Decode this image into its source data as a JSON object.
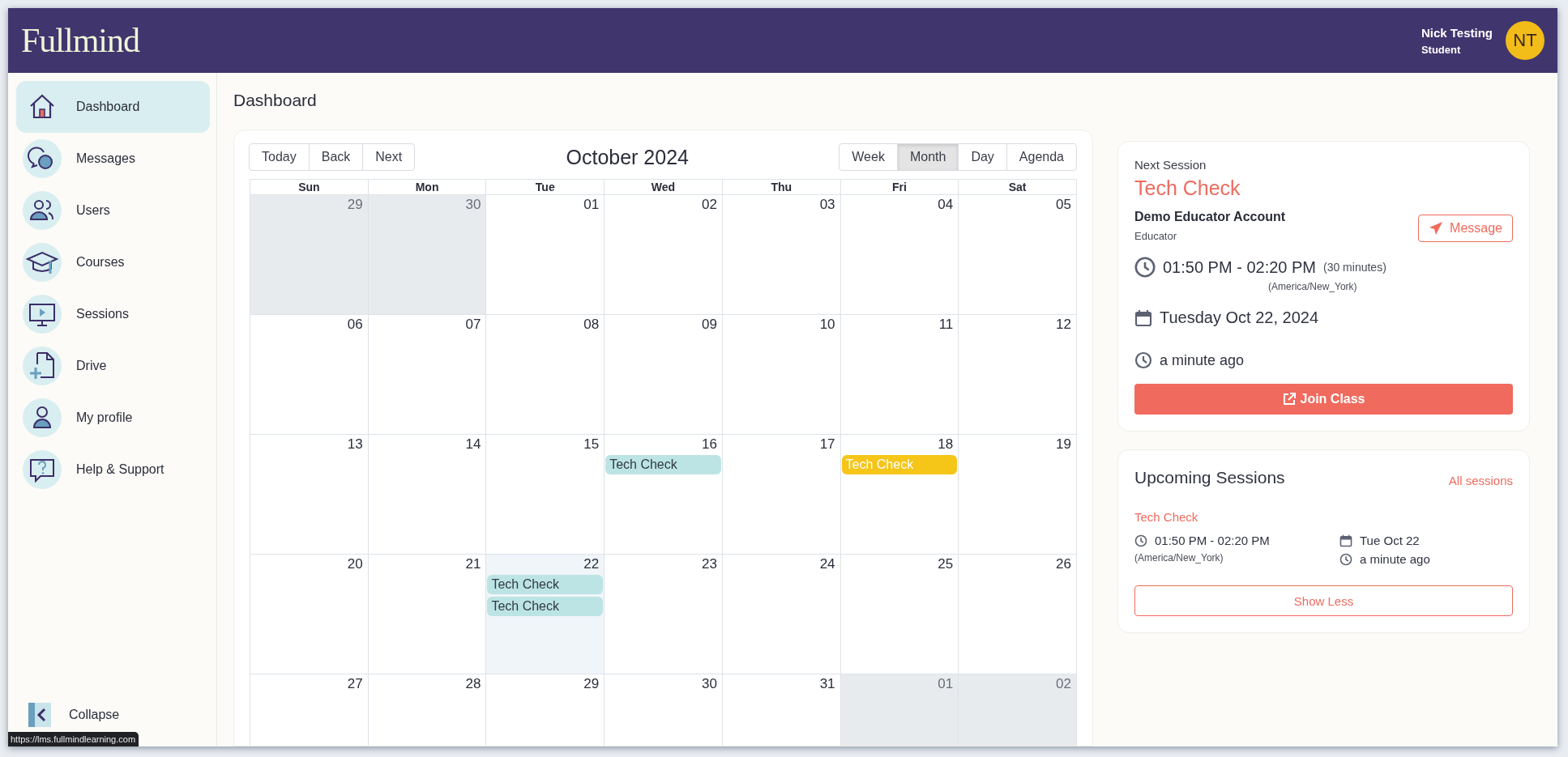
{
  "header": {
    "logo": "Fullmind",
    "user": {
      "name": "Nick Testing",
      "role": "Student",
      "initials": "NT"
    }
  },
  "sidebar": {
    "items": [
      {
        "label": "Dashboard",
        "selected": true
      },
      {
        "label": "Messages",
        "selected": false
      },
      {
        "label": "Users",
        "selected": false
      },
      {
        "label": "Courses",
        "selected": false
      },
      {
        "label": "Sessions",
        "selected": false
      },
      {
        "label": "Drive",
        "selected": false
      },
      {
        "label": "My profile",
        "selected": false
      },
      {
        "label": "Help & Support",
        "selected": false
      }
    ],
    "collapse": "Collapse"
  },
  "page_title": "Dashboard",
  "calendar": {
    "nav_buttons": [
      "Today",
      "Back",
      "Next"
    ],
    "title": "October 2024",
    "views": [
      {
        "label": "Week",
        "selected": false
      },
      {
        "label": "Month",
        "selected": true
      },
      {
        "label": "Day",
        "selected": false
      },
      {
        "label": "Agenda",
        "selected": false
      }
    ],
    "weekdays": [
      "Sun",
      "Mon",
      "Tue",
      "Wed",
      "Thu",
      "Fri",
      "Sat"
    ],
    "days": [
      {
        "number": "29",
        "outside": true,
        "today": false
      },
      {
        "number": "30",
        "outside": true,
        "today": false
      },
      {
        "number": "01",
        "outside": false,
        "today": false
      },
      {
        "number": "02",
        "outside": false,
        "today": false
      },
      {
        "number": "03",
        "outside": false,
        "today": false
      },
      {
        "number": "04",
        "outside": false,
        "today": false
      },
      {
        "number": "05",
        "outside": false,
        "today": false
      },
      {
        "number": "06",
        "outside": false,
        "today": false
      },
      {
        "number": "07",
        "outside": false,
        "today": false
      },
      {
        "number": "08",
        "outside": false,
        "today": false
      },
      {
        "number": "09",
        "outside": false,
        "today": false
      },
      {
        "number": "10",
        "outside": false,
        "today": false
      },
      {
        "number": "11",
        "outside": false,
        "today": false
      },
      {
        "number": "12",
        "outside": false,
        "today": false
      },
      {
        "number": "13",
        "outside": false,
        "today": false
      },
      {
        "number": "14",
        "outside": false,
        "today": false
      },
      {
        "number": "15",
        "outside": false,
        "today": false
      },
      {
        "number": "16",
        "outside": false,
        "today": false,
        "events": [
          {
            "title": "Tech Check",
            "color": "#bde4e4"
          }
        ]
      },
      {
        "number": "17",
        "outside": false,
        "today": false
      },
      {
        "number": "18",
        "outside": false,
        "today": false,
        "events": [
          {
            "title": "Tech Check",
            "color": "#f5c518"
          }
        ]
      },
      {
        "number": "19",
        "outside": false,
        "today": false
      },
      {
        "number": "20",
        "outside": false,
        "today": false
      },
      {
        "number": "21",
        "outside": false,
        "today": false
      },
      {
        "number": "22",
        "outside": false,
        "today": true,
        "events": [
          {
            "title": "Tech Check",
            "color": "#bde4e4"
          },
          {
            "title": "Tech Check",
            "color": "#bde4e4"
          }
        ]
      },
      {
        "number": "23",
        "outside": false,
        "today": false
      },
      {
        "number": "24",
        "outside": false,
        "today": false
      },
      {
        "number": "25",
        "outside": false,
        "today": false
      },
      {
        "number": "26",
        "outside": false,
        "today": false
      },
      {
        "number": "27",
        "outside": false,
        "today": false
      },
      {
        "number": "28",
        "outside": false,
        "today": false
      },
      {
        "number": "29",
        "outside": false,
        "today": false
      },
      {
        "number": "30",
        "outside": false,
        "today": false
      },
      {
        "number": "31",
        "outside": false,
        "today": false
      },
      {
        "number": "01",
        "outside": true,
        "today": false
      },
      {
        "number": "02",
        "outside": true,
        "today": false
      }
    ]
  },
  "next_session": {
    "heading": "Next Session",
    "title": "Tech Check",
    "educator": "Demo Educator Account",
    "educator_role": "Educator",
    "message_button": "Message",
    "time": "01:50 PM - 02:20 PM",
    "duration": "(30 minutes)",
    "timezone": "(America/New_York)",
    "date": "Tuesday Oct 22, 2024",
    "relative": "a minute ago",
    "join_button": "Join Class"
  },
  "upcoming_sessions": {
    "heading": "Upcoming Sessions",
    "all_link": "All sessions",
    "sessions": [
      {
        "title": "Tech Check",
        "time": "01:50 PM - 02:20 PM",
        "timezone": "(America/New_York)",
        "date": "Tue Oct 22",
        "relative": "a minute ago"
      }
    ],
    "toggle_button": "Show Less"
  },
  "status_url": "https://lms.fullmindlearning.com"
}
